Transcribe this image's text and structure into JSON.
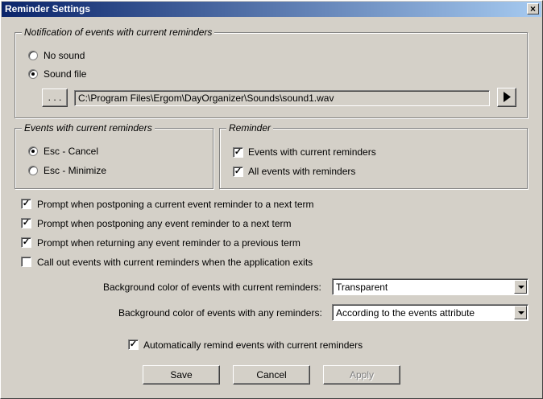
{
  "window": {
    "title": "Reminder Settings",
    "close_glyph": "×"
  },
  "notification": {
    "legend": "Notification of events with current reminders",
    "options": [
      {
        "label": "No sound",
        "checked": false
      },
      {
        "label": "Sound file",
        "checked": true
      }
    ],
    "browse_label": ". . .",
    "sound_path": "C:\\Program Files\\Ergom\\DayOrganizer\\Sounds\\sound1.wav",
    "play_icon": "play-icon"
  },
  "events_group": {
    "legend": "Events with current reminders",
    "options": [
      {
        "label": "Esc - Cancel",
        "checked": true
      },
      {
        "label": "Esc - Minimize",
        "checked": false
      }
    ]
  },
  "reminder_group": {
    "legend": "Reminder",
    "options": [
      {
        "label": "Events with current reminders",
        "checked": true
      },
      {
        "label": "All events with reminders",
        "checked": true
      }
    ]
  },
  "prompts": [
    {
      "label": "Prompt when postponing a current event reminder to a next term",
      "checked": true
    },
    {
      "label": "Prompt when postponing any event reminder to a next term",
      "checked": true
    },
    {
      "label": "Prompt when returning any event reminder to a previous term",
      "checked": true
    },
    {
      "label": "Call out events with current reminders when the application exits",
      "checked": false
    }
  ],
  "colors": {
    "current_label": "Background color of events with current reminders:",
    "current_value": "Transparent",
    "any_label": "Background color of events with any reminders:",
    "any_value": "According to the events attribute"
  },
  "auto_remind": {
    "label": "Automatically remind events with current reminders",
    "checked": true
  },
  "buttons": {
    "save": "Save",
    "cancel": "Cancel",
    "apply": "Apply"
  },
  "check_glyph": "✓"
}
